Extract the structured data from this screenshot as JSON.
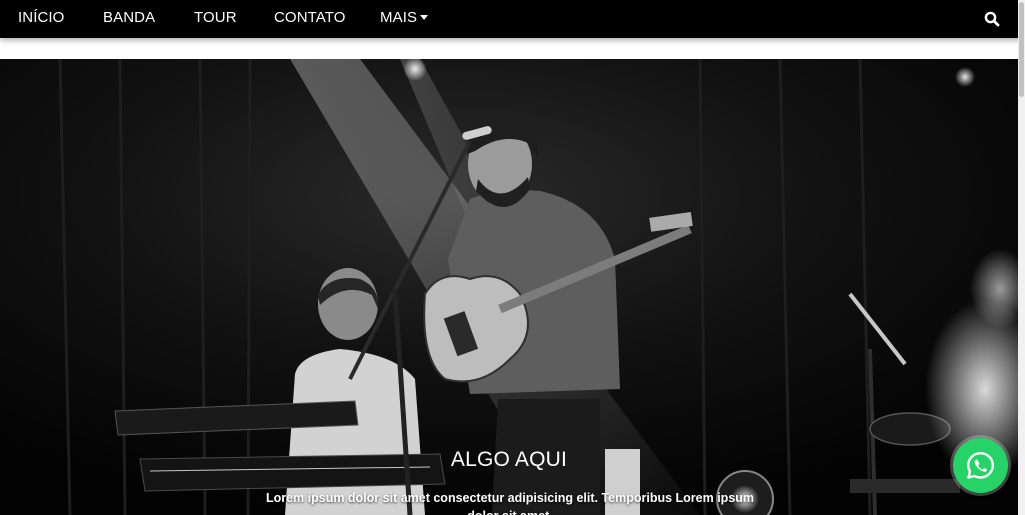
{
  "nav": {
    "items": [
      {
        "label": "INÍCIO"
      },
      {
        "label": "BANDA"
      },
      {
        "label": "TOUR"
      },
      {
        "label": "CONTATO"
      },
      {
        "label": "MAIS"
      }
    ],
    "search_icon": "search-icon",
    "more_icon": "caret-down-icon"
  },
  "hero": {
    "image": "band-performing-on-stage-photo",
    "caption_title": "ALGO AQUI",
    "caption_text": "Lorem ipsum dolor sit amet consectetur adipisicing elit. Temporibus Lorem ipsum dolor sit amet."
  },
  "whatsapp": {
    "icon": "whatsapp-icon",
    "color": "#25d366"
  },
  "colors": {
    "navbar": "#000000",
    "text": "#ffffff"
  }
}
